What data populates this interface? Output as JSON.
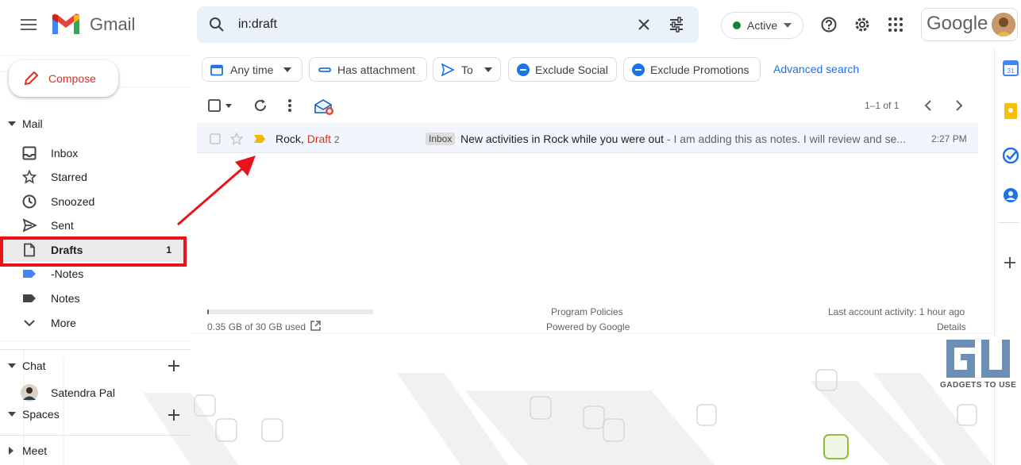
{
  "header": {
    "brand": "Gmail",
    "search_value": "in:draft",
    "status_label": "Active",
    "google_word": "Google"
  },
  "compose": {
    "label": "Compose"
  },
  "sidebar": {
    "mail_section": "Mail",
    "items": [
      {
        "label": "Inbox",
        "count": ""
      },
      {
        "label": "Starred",
        "count": ""
      },
      {
        "label": "Snoozed",
        "count": ""
      },
      {
        "label": "Sent",
        "count": ""
      },
      {
        "label": "Drafts",
        "count": "1"
      },
      {
        "label": "-Notes",
        "count": ""
      },
      {
        "label": "Notes",
        "count": ""
      },
      {
        "label": "More",
        "count": ""
      }
    ],
    "chat_section": "Chat",
    "chat_user": "Satendra Pal",
    "spaces_section": "Spaces",
    "meet_section": "Meet"
  },
  "filters": {
    "chips": [
      "Any time",
      "Has attachment",
      "To",
      "Exclude Social",
      "Exclude Promotions"
    ],
    "advanced": "Advanced search"
  },
  "toolbar": {
    "paging": "1–1 of 1"
  },
  "messages": [
    {
      "sender": "Rock,",
      "draft_label": "Draft",
      "thread_count": "2",
      "label_badge": "Inbox",
      "subject": "New activities in Rock while you were out",
      "snippet": " - I am adding this as notes. I will review and se...",
      "time": "2:27 PM"
    }
  ],
  "footer": {
    "storage": "0.35 GB of 30 GB used",
    "storage_fraction": 0.0117,
    "program_policies": "Program Policies",
    "powered_by": "Powered by Google",
    "last_activity": "Last account activity: 1 hour ago",
    "details": "Details"
  },
  "watermark": {
    "text": "GADGETS TO USE"
  },
  "colors": {
    "accent_red": "#e8141b",
    "gmail_red": "#d93025",
    "link_blue": "#1a73e8",
    "active_green": "#188038",
    "selected_row": "#f2f6fc"
  }
}
